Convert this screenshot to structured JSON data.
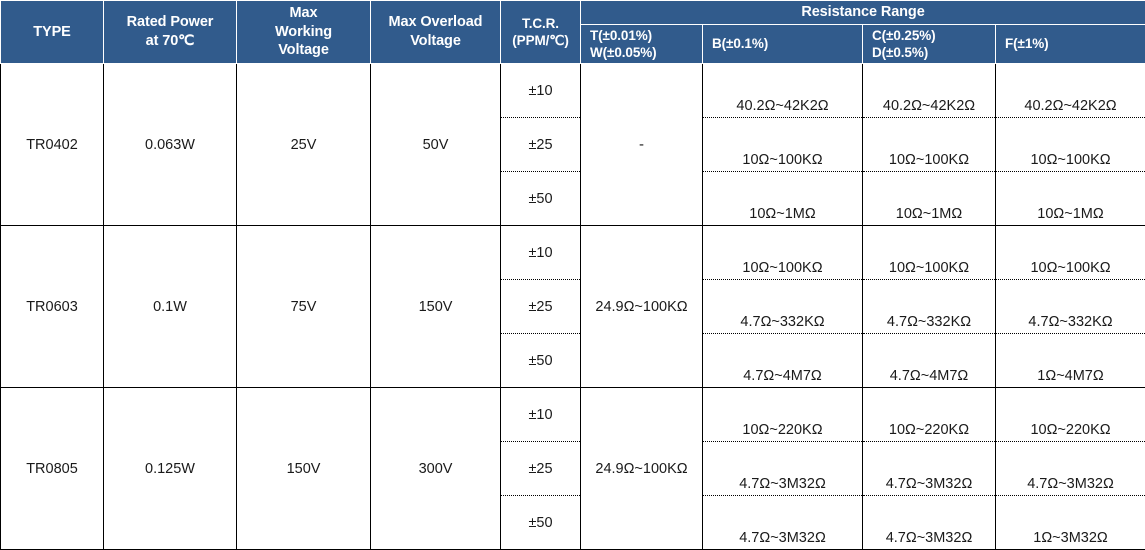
{
  "table": {
    "headers": {
      "type": "TYPE",
      "rated_power": "Rated Power\nat 70℃",
      "rated_power_line1": "Rated Power",
      "rated_power_line2": "at 70℃",
      "max_working_voltage_line1": "Max",
      "max_working_voltage_line2": "Working",
      "max_working_voltage_line3": "Voltage",
      "max_overload_voltage_line1": "Max Overload",
      "max_overload_voltage_line2": "Voltage",
      "tcr_line1": "T.C.R.",
      "tcr_line2": "(PPM/℃)",
      "resistance_range": "Resistance Range",
      "tol_tw_line1": "T(±0.01%)",
      "tol_tw_line2": "W(±0.05%)",
      "tol_b": "B(±0.1%)",
      "tol_cd_line1": "C(±0.25%)",
      "tol_cd_line2": "D(±0.5%)",
      "tol_f": "F(±1%)"
    },
    "rows": [
      {
        "type": "TR0402",
        "rated_power": "0.063W",
        "max_working_voltage": "25V",
        "max_overload_voltage": "50V",
        "tcr_values": [
          "±10",
          "±25",
          "±50"
        ],
        "tw": "-",
        "tw_is_merged": true,
        "b": [
          "40.2Ω~42K2Ω",
          "10Ω~100KΩ",
          "10Ω~1MΩ"
        ],
        "cd": [
          "40.2Ω~42K2Ω",
          "10Ω~100KΩ",
          "10Ω~1MΩ"
        ],
        "f": [
          "40.2Ω~42K2Ω",
          "10Ω~100KΩ",
          "10Ω~1MΩ"
        ]
      },
      {
        "type": "TR0603",
        "rated_power": "0.1W",
        "max_working_voltage": "75V",
        "max_overload_voltage": "150V",
        "tcr_values": [
          "±10",
          "±25",
          "±50"
        ],
        "tw": "24.9Ω~100KΩ",
        "tw_is_merged": true,
        "b": [
          "10Ω~100KΩ",
          "4.7Ω~332KΩ",
          "4.7Ω~4M7Ω"
        ],
        "cd": [
          "10Ω~100KΩ",
          "4.7Ω~332KΩ",
          "4.7Ω~4M7Ω"
        ],
        "f": [
          "10Ω~100KΩ",
          "4.7Ω~332KΩ",
          "1Ω~4M7Ω"
        ]
      },
      {
        "type": "TR0805",
        "rated_power": "0.125W",
        "max_working_voltage": "150V",
        "max_overload_voltage": "300V",
        "tcr_values": [
          "±10",
          "±25",
          "±50"
        ],
        "tw": "24.9Ω~100KΩ",
        "tw_is_merged": true,
        "b": [
          "10Ω~220KΩ",
          "4.7Ω~3M32Ω",
          "4.7Ω~3M32Ω"
        ],
        "cd": [
          "10Ω~220KΩ",
          "4.7Ω~3M32Ω",
          "4.7Ω~3M32Ω"
        ],
        "f": [
          "10Ω~220KΩ",
          "4.7Ω~3M32Ω",
          "1Ω~3M32Ω"
        ]
      }
    ],
    "colors": {
      "header_background": "#315b8c",
      "header_text": "#ffffff",
      "body_text": "#1a1a1a",
      "border": "#000000",
      "background": "#ffffff"
    }
  }
}
